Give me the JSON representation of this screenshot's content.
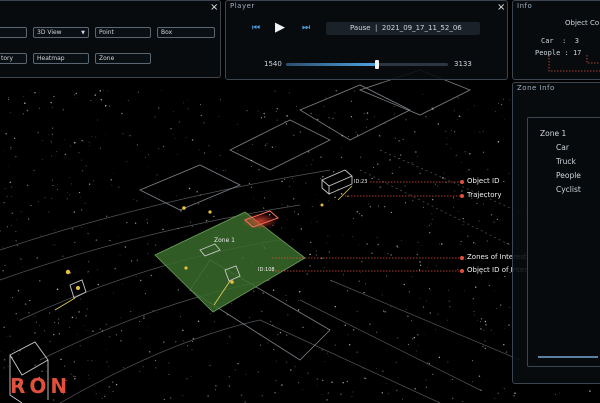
{
  "toolbar": {
    "close_icon": "×",
    "fields": [
      {
        "label": "3D View",
        "has_dropdown": true
      },
      {
        "label": "Point"
      },
      {
        "label": "Box"
      },
      {
        "label": "tory"
      },
      {
        "label": "Heatmap"
      },
      {
        "label": "Zone"
      }
    ]
  },
  "player": {
    "title": "Player",
    "close_icon": "×",
    "state": "Pause",
    "recording": "2021_09_17_11_52_06",
    "frame_start": "1540",
    "frame_end": "3133",
    "progress": 0.56,
    "icons": [
      "skip-back-icon",
      "play-icon",
      "skip-forward-icon"
    ]
  },
  "info": {
    "title": "Info",
    "header": "Object Co",
    "rows": [
      {
        "label": "Car",
        "sep": ":",
        "value": "3"
      },
      {
        "label": "People",
        "sep": ":",
        "value": "17"
      }
    ]
  },
  "zone_info": {
    "title": "Zone Info",
    "zone": "Zone 1",
    "items": [
      "Car",
      "Truck",
      "People",
      "Cyclist"
    ]
  },
  "scene": {
    "zone_label": "Zone 1",
    "object_tags": [
      "ID:23",
      "ID:108"
    ]
  },
  "annotations": [
    {
      "text": "Object ID"
    },
    {
      "text": "Trajectory"
    },
    {
      "text": "Zones of Interest"
    },
    {
      "text": "Object ID of Interest"
    }
  ],
  "brand": {
    "partial_logo": "RON"
  },
  "colors": {
    "accent": "#e0503c",
    "zone": "#3a6b2a",
    "panel_border": "#3b4650",
    "progress": "#4fa3e0"
  }
}
